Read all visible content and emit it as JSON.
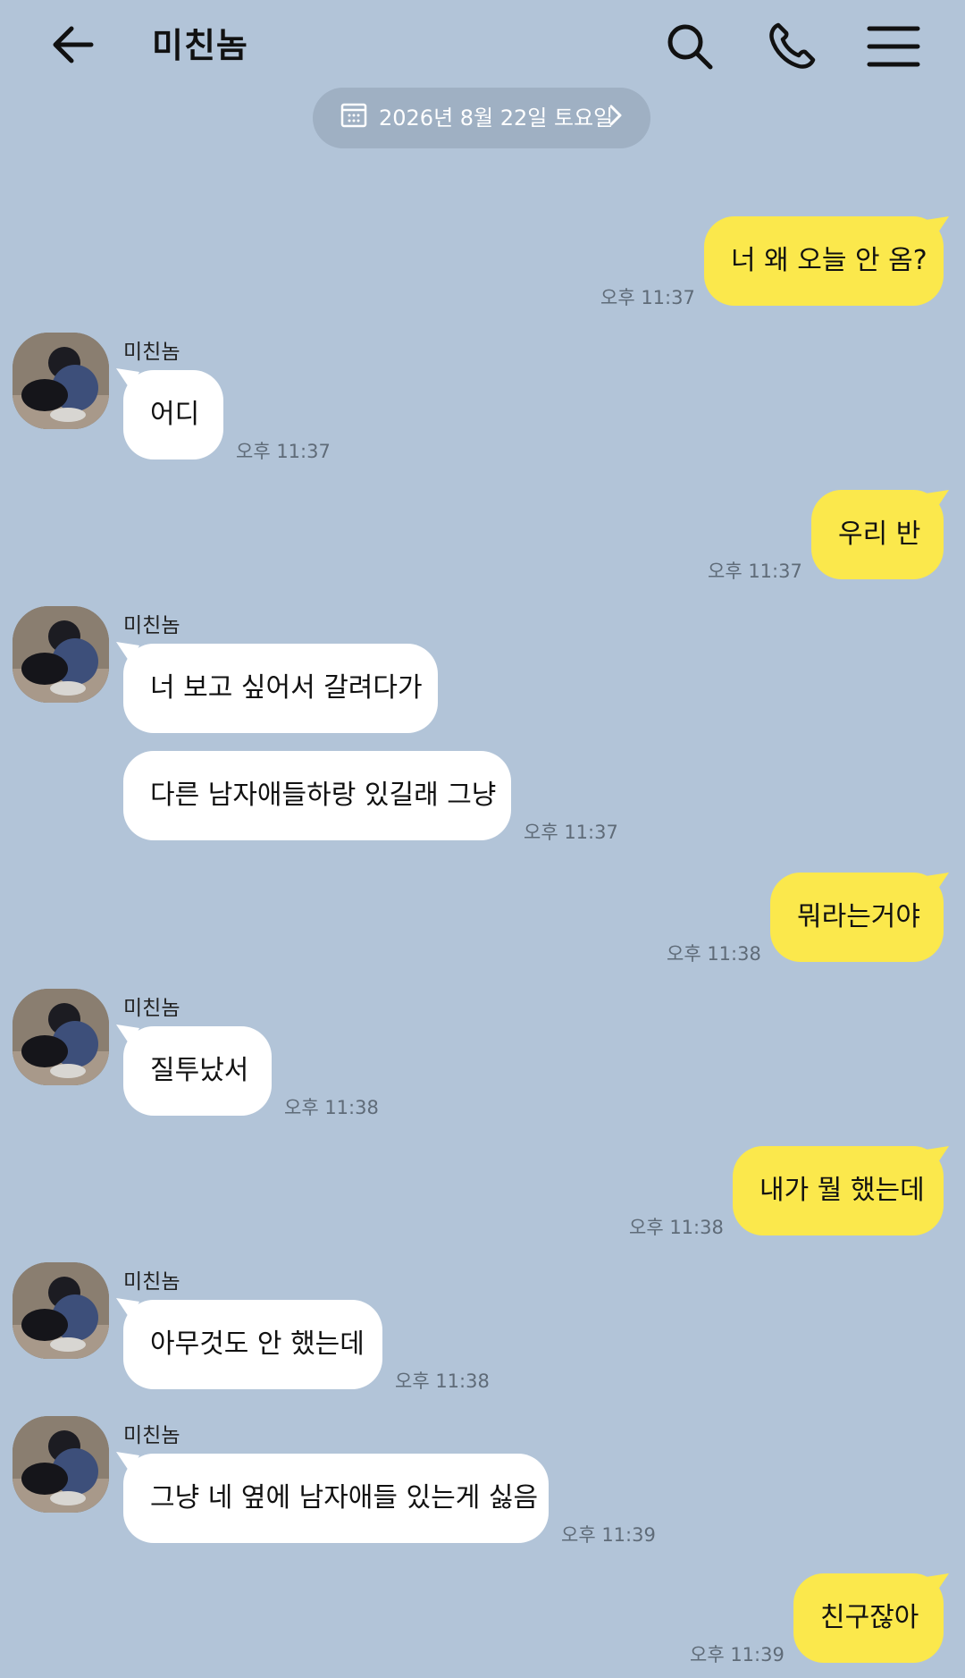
{
  "header": {
    "title": "미친놈",
    "icons": [
      "back-arrow-icon",
      "search-icon",
      "phone-call-icon",
      "hamburger-menu-icon"
    ]
  },
  "date_divider": {
    "label": "2026년 8월 22일 토요일",
    "icon": "calendar-icon"
  },
  "colors": {
    "background": "#b2c4d8",
    "my_bubble": "#fbe84c",
    "their_bubble": "#ffffff",
    "time_text": "#5f6b78"
  },
  "messages": [
    {
      "from": "me",
      "text": "너 왜 오늘 안 옴?",
      "time": "오후 11:37"
    },
    {
      "from": "friend",
      "sender": "미친놈",
      "text": "어디",
      "time": "오후 11:37"
    },
    {
      "from": "me",
      "text": "우리 반",
      "time": "오후 11:37"
    },
    {
      "from": "friend",
      "sender": "미친놈",
      "text": "너 보고 싶어서 갈려다가",
      "time": ""
    },
    {
      "from": "friend",
      "sender": "",
      "text": "다른 남자애들하랑 있길래 그냥",
      "time": "오후 11:37"
    },
    {
      "from": "me",
      "text": "뭐라는거야",
      "time": "오후 11:38"
    },
    {
      "from": "friend",
      "sender": "미친놈",
      "text": "질투났서",
      "time": "오후 11:38"
    },
    {
      "from": "me",
      "text": "내가 뭘 했는데",
      "time": "오후 11:38"
    },
    {
      "from": "friend",
      "sender": "미친놈",
      "text": "아무것도 안 했는데",
      "time": "오후 11:38"
    },
    {
      "from": "friend",
      "sender": "미친놈",
      "text": "그냥 네 옆에 남자애들 있는게 싫음",
      "time": "오후 11:39"
    },
    {
      "from": "me",
      "text": "친구잖아",
      "time": "오후 11:39"
    }
  ]
}
